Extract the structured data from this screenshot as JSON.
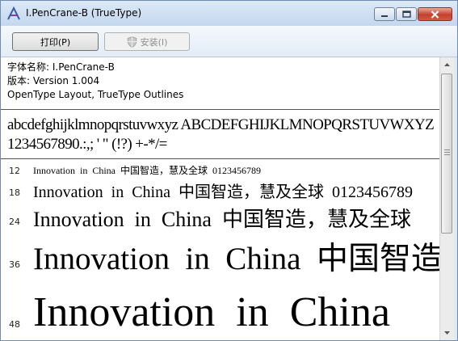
{
  "window": {
    "title": "I.PenCrane-B (TrueType)",
    "icon": "font-viewer-icon",
    "accent": "#6e8bb0"
  },
  "toolbar": {
    "print_label": "打印(P)",
    "install_label": "安装(I)",
    "install_icon": "shield-icon"
  },
  "font_info": {
    "name_line": "字体名称: I.PenCrane-B",
    "version_line": "版本: Version 1.004",
    "type_line": "OpenType Layout, TrueType Outlines"
  },
  "charset": {
    "line1": "abcdefghijklmnopqrstuvwxyz  ABCDEFGHIJKLMNOPQRSTUVWXYZ",
    "line2": "1234567890.:,; ' \" (!?) +-*/="
  },
  "samples": [
    {
      "size": "12",
      "text": "Innovation in China 中国智造，慧及全球 0123456789"
    },
    {
      "size": "18",
      "text": "Innovation in China 中国智造，慧及全球 0123456789"
    },
    {
      "size": "24",
      "text": "Innovation in China 中国智造，慧及全球"
    },
    {
      "size": "36",
      "text": "Innovation in China 中国智造"
    },
    {
      "size": "48",
      "text": "Innovation in China"
    }
  ]
}
